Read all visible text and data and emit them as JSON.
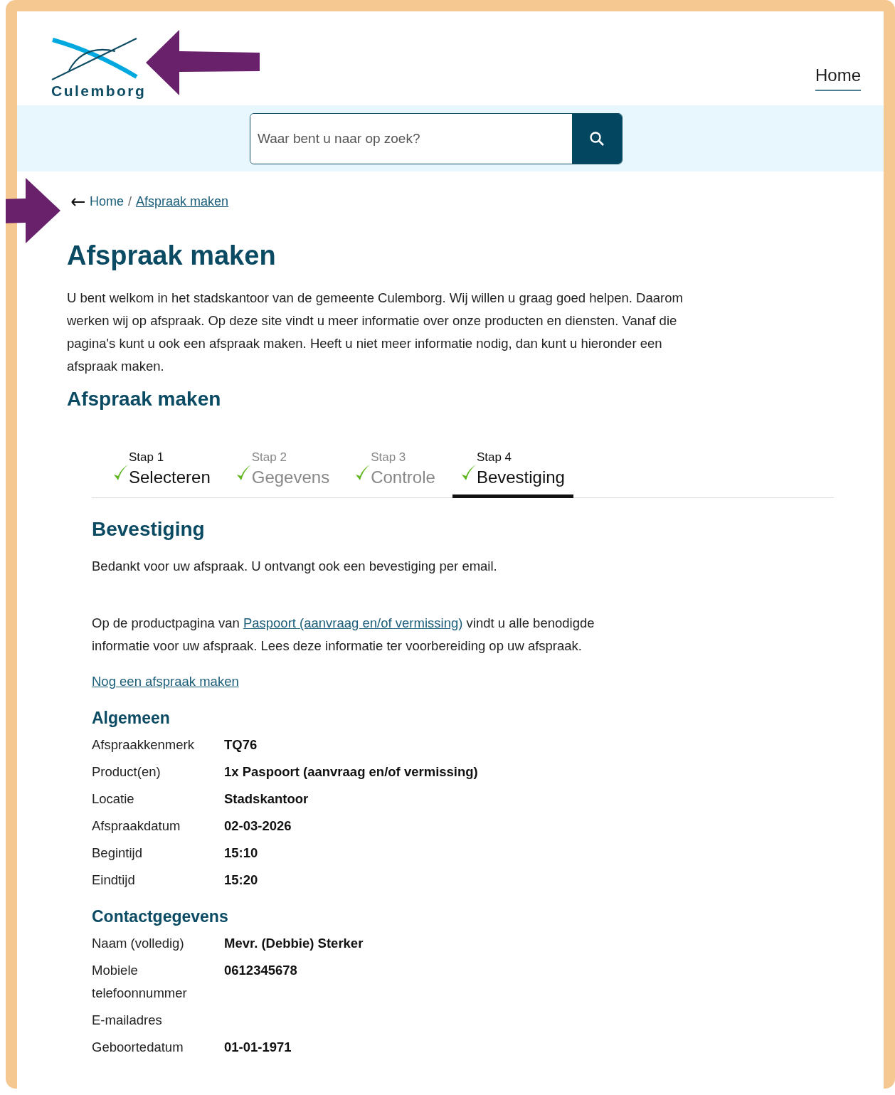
{
  "header": {
    "logo_text": "Culemborg",
    "nav": [
      {
        "label": "Home",
        "selected": true
      }
    ]
  },
  "search": {
    "placeholder": "Waar bent u naar op zoek?"
  },
  "breadcrumb": {
    "separator": "/",
    "items": [
      {
        "label": "Home",
        "current": false
      },
      {
        "label": "Afspraak maken",
        "current": true
      }
    ]
  },
  "title": "Afspraak maken",
  "intro": "U bent welkom in het stadskantoor van de gemeente Culemborg. Wij willen u graag goed helpen. Daarom werken wij op afspraak. Op deze site vindt u meer informatie over onze producten en diensten. Vanaf die pagina's kunt u ook een afspraak maken. Heeft u niet meer informatie nodig, dan kunt u hieronder een afspraak maken.",
  "subtitle": "Afspraak maken",
  "steps": [
    {
      "number": "Stap 1",
      "label": "Selecteren",
      "done": true,
      "dimmed": false,
      "selected": false
    },
    {
      "number": "Stap 2",
      "label": "Gegevens",
      "done": true,
      "dimmed": true,
      "selected": false
    },
    {
      "number": "Stap 3",
      "label": "Controle",
      "done": true,
      "dimmed": true,
      "selected": false
    },
    {
      "number": "Stap 4",
      "label": "Bevestiging",
      "done": true,
      "dimmed": false,
      "selected": true
    }
  ],
  "confirmation": {
    "heading": "Bevestiging",
    "thanks": "Bedankt voor uw afspraak. U ontvangt ook een bevestiging per email.",
    "info_before": "Op de productpagina van ",
    "info_link": "Paspoort (aanvraag en/of vermissing)",
    "info_after": " vindt u alle benodigde informatie voor uw afspraak. Lees deze informatie ter voorbereiding op uw afspraak.",
    "again_link": "Nog een afspraak maken"
  },
  "sections": [
    {
      "heading": "Algemeen",
      "rows": [
        {
          "label": "Afspraakkenmerk",
          "value": "TQ76"
        },
        {
          "label": "Product(en)",
          "value": "1x Paspoort (aanvraag en/of vermissing)"
        },
        {
          "label": "Locatie",
          "value": "Stadskantoor"
        },
        {
          "label": "Afspraakdatum",
          "value": "02-03-2026"
        },
        {
          "label": "Begintijd",
          "value": "15:10"
        },
        {
          "label": "Eindtijd",
          "value": "15:20"
        }
      ]
    },
    {
      "heading": "Contactgegevens",
      "rows": [
        {
          "label": "Naam (volledig)",
          "value": "Mevr. (Debbie) Sterker"
        },
        {
          "label": "Mobiele telefoonnummer",
          "value": "0612345678"
        },
        {
          "label": "E-mailadres"
        },
        {
          "label": "Geboortedatum",
          "value": "01-01-1971"
        }
      ]
    }
  ]
}
